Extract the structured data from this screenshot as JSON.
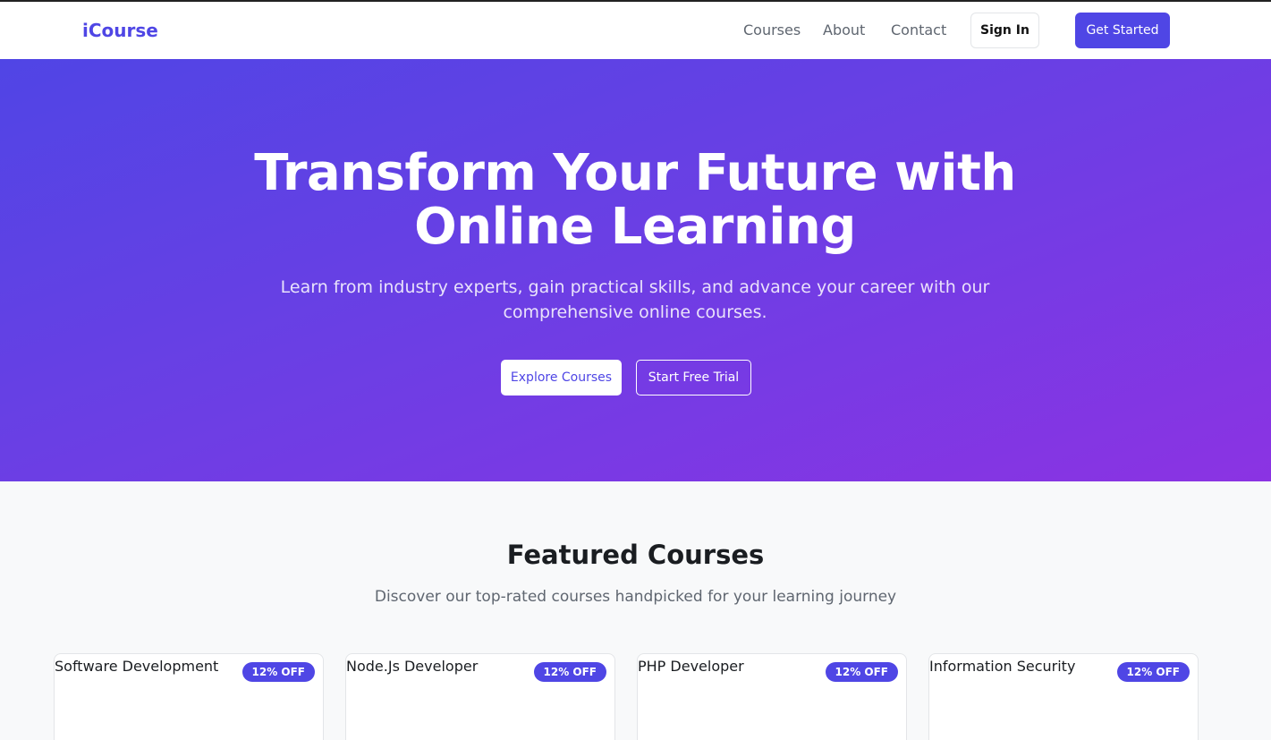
{
  "nav": {
    "brand": "iCourse",
    "links": [
      "Courses",
      "About",
      "Contact"
    ],
    "sign_in": "Sign In",
    "get_started": "Get Started"
  },
  "hero": {
    "title": "Transform Your Future with Online Learning",
    "subtitle": "Learn from industry experts, gain practical skills, and advance your career with our comprehensive online courses.",
    "explore_button": "Explore Courses",
    "trial_button": "Start Free Trial"
  },
  "featured": {
    "title": "Featured Courses",
    "subtitle": "Discover our top-rated courses handpicked for your learning journey",
    "courses": [
      {
        "title": "Software Development",
        "badge": "12% OFF"
      },
      {
        "title": "Node.Js Developer",
        "badge": "12% OFF"
      },
      {
        "title": "PHP Developer",
        "badge": "12% OFF"
      },
      {
        "title": "Information Security",
        "badge": "12% OFF"
      }
    ]
  },
  "colors": {
    "brand": "#4f46e5",
    "hero_gradient_start": "#5045e5",
    "hero_gradient_end": "#8b33e3"
  }
}
